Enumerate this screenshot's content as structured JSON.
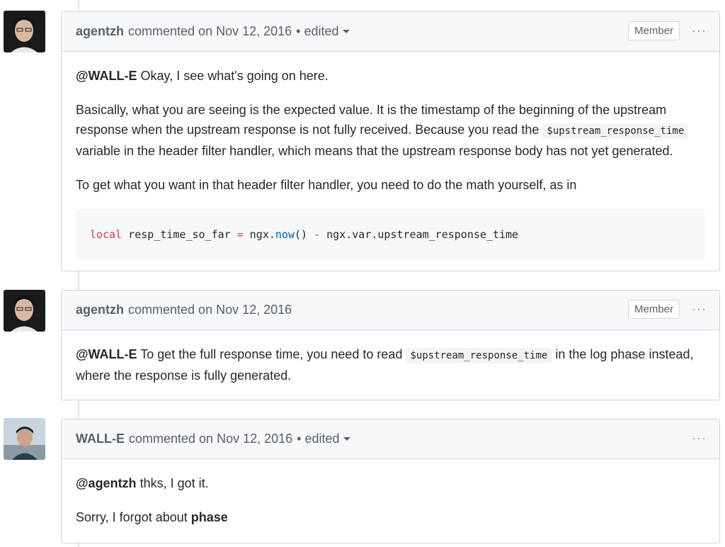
{
  "comments": [
    {
      "author": "agentzh",
      "meta": "commented on Nov 12, 2016",
      "edited": "• edited",
      "badge": "Member",
      "more": "···",
      "mention": "@WALL-E",
      "p1_text": " Okay, I see what's going on here.",
      "p2_before": "Basically, what you are seeing is the expected value. It is the timestamp of the beginning of the upstream response when the upstream response is not fully received. Because you read the ",
      "p2_code": "$upstream_response_time",
      "p2_after": " variable in the header filter handler, which means that the upstream response body has not yet generated.",
      "p3": "To get what you want in that header filter handler, you need to do the math yourself, as in",
      "code": {
        "kw": "local",
        "var": " resp_time_so_far ",
        "eq": "=",
        "obj1": " ngx.",
        "fn": "now",
        "paren": "() ",
        "minus": "-",
        "rest": " ngx.var.upstream_response_time"
      }
    },
    {
      "author": "agentzh",
      "meta": "commented on Nov 12, 2016",
      "badge": "Member",
      "more": "···",
      "mention": "@WALL-E",
      "p1_before": " To get the full response time, you need to read ",
      "p1_code": "$upstream_response_time",
      "p1_after": " in the log phase instead, where the response is fully generated."
    },
    {
      "author": "WALL-E",
      "meta": "commented on Nov 12, 2016",
      "edited": "• edited",
      "more": "···",
      "mention": "@agentzh",
      "p1_text": " thks, I got it.",
      "p2_before": "Sorry, I forgot about ",
      "p2_bold": "phase"
    }
  ]
}
